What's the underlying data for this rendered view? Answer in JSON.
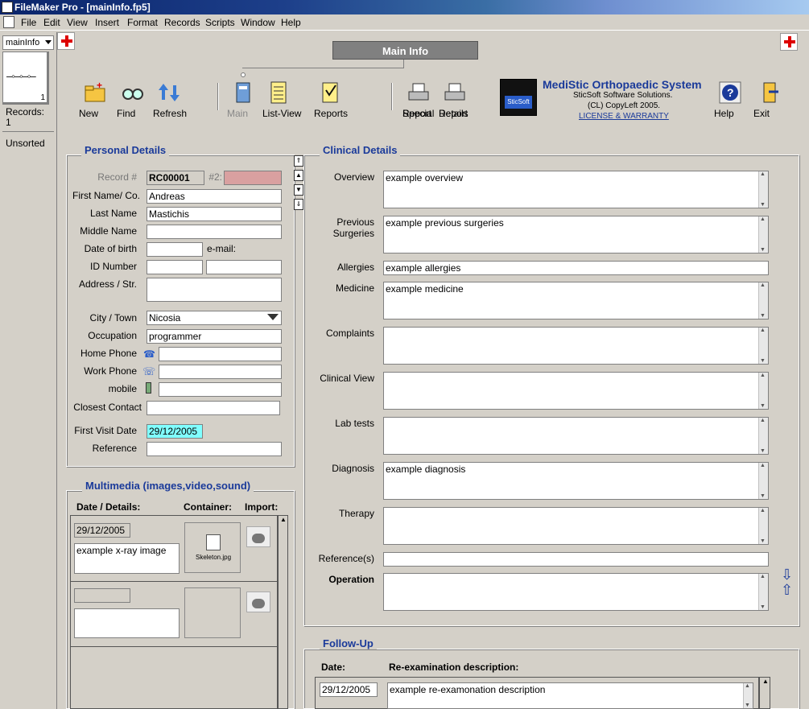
{
  "window": {
    "title": "FileMaker Pro - [mainInfo.fp5]"
  },
  "menu": [
    "File",
    "Edit",
    "View",
    "Insert",
    "Format",
    "Records",
    "Scripts",
    "Window",
    "Help"
  ],
  "sidebar": {
    "layout": "mainInfo",
    "book_page": "1",
    "records_label": "Records:",
    "records_count": "1",
    "sort_state": "Unsorted"
  },
  "header": {
    "tab": "Main Info"
  },
  "toolbar": {
    "new": "New",
    "find": "Find",
    "refresh": "Refresh",
    "main": "Main",
    "list_view": "List-View",
    "reports": "Reports",
    "special_report_1": "Special",
    "special_report_2": "Report",
    "details_report_1": "Details",
    "details_report_2": "Report",
    "help": "Help",
    "exit": "Exit"
  },
  "brand": {
    "logo_text": "SticSoft",
    "name": "MediStic Orthopaedic System",
    "company": "SticSoft Software Solutions.",
    "copyleft": "(CL) CopyLeft 2005.",
    "license": "LICENSE & WARRANTY"
  },
  "personal": {
    "title": "Personal Details",
    "record_label": "Record #",
    "record_value": "RC00001",
    "second_label": "#2:",
    "second_value": "",
    "first_name_label": "First Name/ Co.",
    "first_name": "Andreas",
    "last_name_label": "Last Name",
    "last_name": "Mastichis",
    "middle_name_label": "Middle Name",
    "middle_name": "",
    "dob_label": "Date of birth",
    "dob": "",
    "email_label": "e-mail:",
    "id_label": "ID Number",
    "id_value": "",
    "id_value2": "",
    "address_label": "Address / Str.",
    "address": "",
    "city_label": "City / Town",
    "city": "Nicosia",
    "occupation_label": "Occupation",
    "occupation": "programmer",
    "home_phone_label": "Home Phone",
    "home_phone": "",
    "work_phone_label": "Work Phone",
    "work_phone": "",
    "mobile_label": "mobile",
    "mobile": "",
    "contact_label": "Closest Contact",
    "contact": "",
    "first_visit_label": "First Visit Date",
    "first_visit": "29/12/2005",
    "reference_label": "Reference",
    "reference": ""
  },
  "multimedia": {
    "title": "Multimedia (images,video,sound)",
    "col_date": "Date / Details:",
    "col_container": "Container:",
    "col_import": "Import:",
    "rows": [
      {
        "date": "29/12/2005",
        "details": "example x-ray image",
        "file": "Skeleton.jpg"
      },
      {
        "date": "",
        "details": "",
        "file": ""
      }
    ]
  },
  "clinical": {
    "title": "Clinical Details",
    "overview_label": "Overview",
    "overview": "example overview",
    "prev_label_1": "Previous",
    "prev_label_2": "Surgeries",
    "prev": "example previous surgeries",
    "allergies_label": "Allergies",
    "allergies": "example allergies",
    "medicine_label": "Medicine",
    "medicine": "example medicine",
    "complaints_label": "Complaints",
    "complaints": "",
    "clinical_view_label": "Clinical View",
    "clinical_view": "",
    "lab_label": "Lab tests",
    "lab": "",
    "diagnosis_label": "Diagnosis",
    "diagnosis": "example diagnosis",
    "therapy_label": "Therapy",
    "therapy": "",
    "refs_label": "Reference(s)",
    "refs": "",
    "operation_label": "Operation",
    "operation": ""
  },
  "followup": {
    "title": "Follow-Up",
    "col_date": "Date:",
    "col_desc": "Re-examination description:",
    "date": "29/12/2005",
    "desc": "example re-examonation description"
  }
}
